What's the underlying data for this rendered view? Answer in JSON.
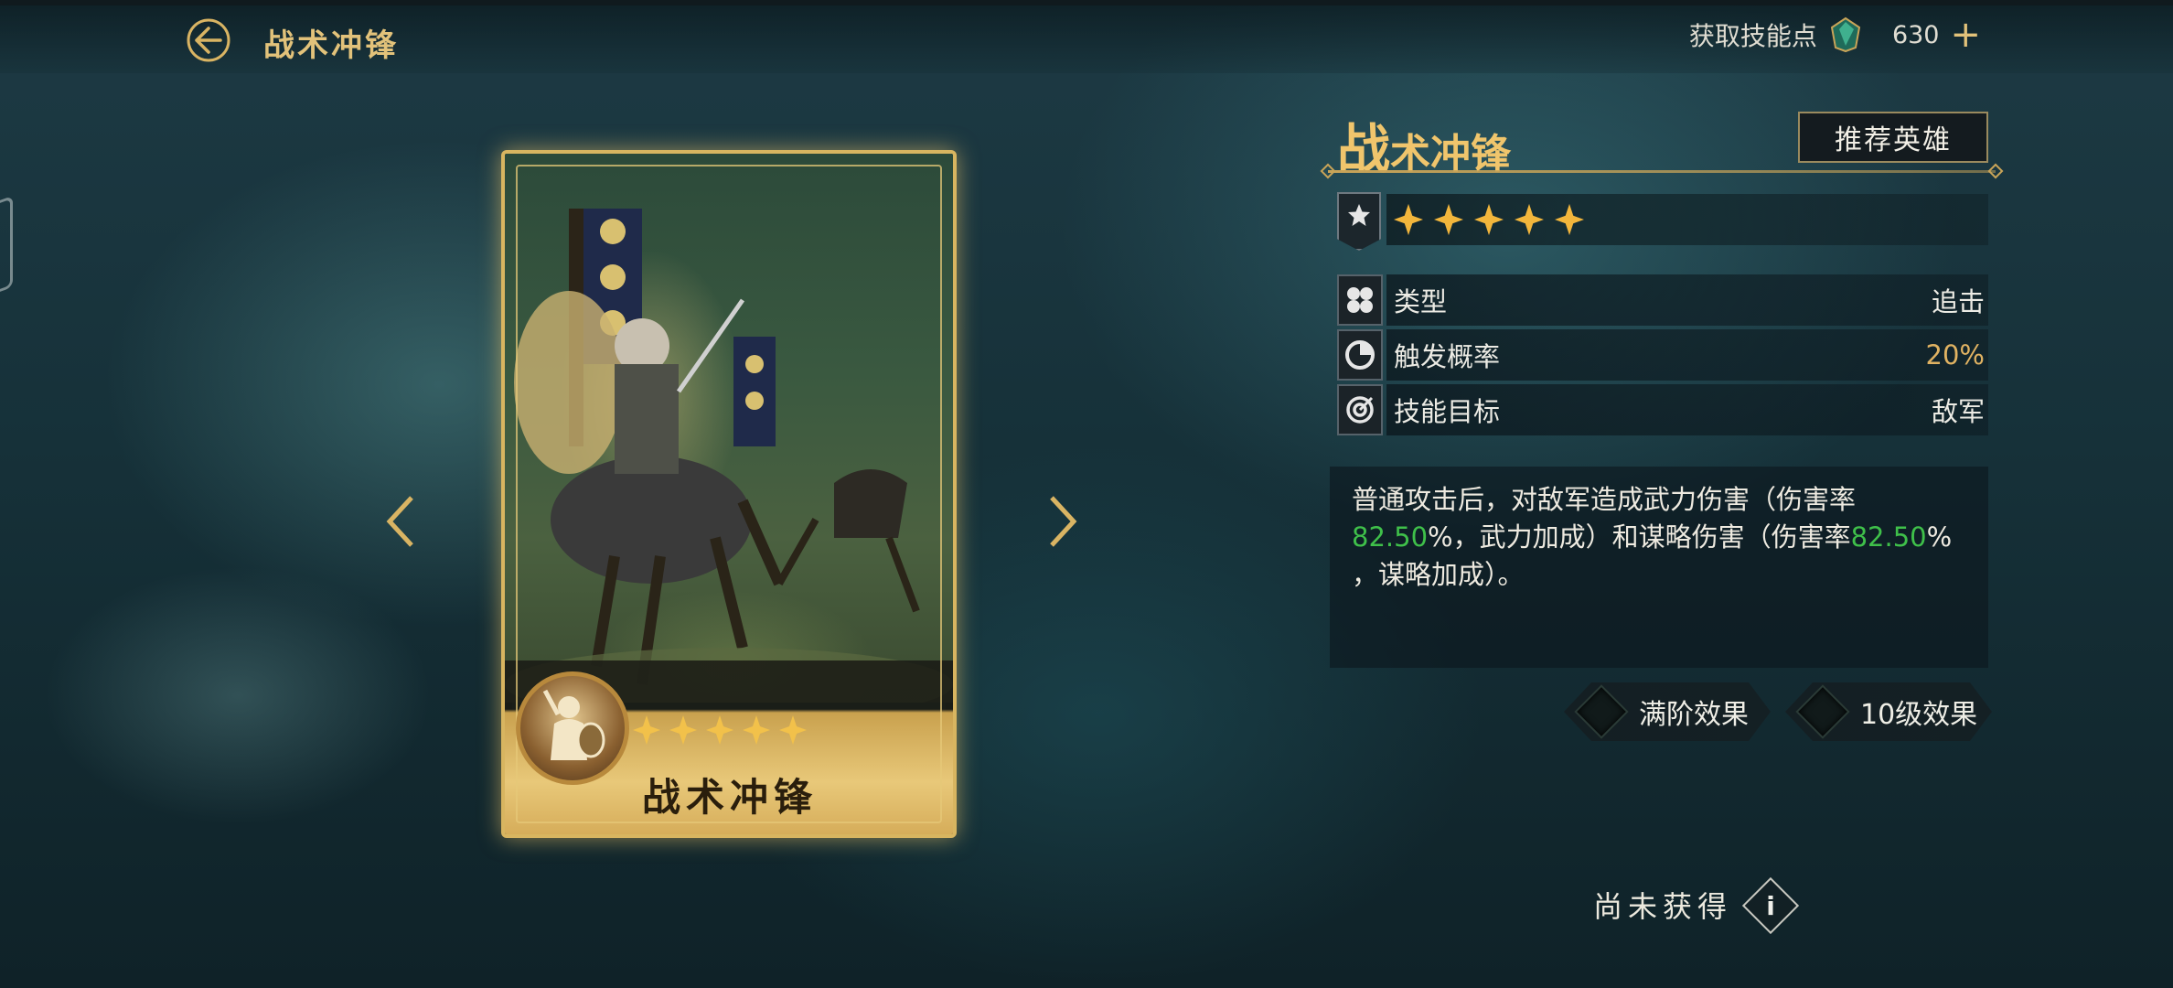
{
  "header": {
    "title": "战术冲锋",
    "skill_points_label": "获取技能点",
    "skill_points_value": "630",
    "add_label": "+"
  },
  "card": {
    "name": "战术冲锋",
    "stars": 5
  },
  "skill": {
    "title_first": "战",
    "title_rest": "术冲锋",
    "recommend_label": "推荐英雄",
    "stars": 5,
    "attributes": [
      {
        "label": "类型",
        "value": "追击",
        "icon": "clover-icon"
      },
      {
        "label": "触发概率",
        "value": "20%",
        "icon": "pie-chart-icon"
      },
      {
        "label": "技能目标",
        "value": "敌军",
        "icon": "target-icon"
      }
    ],
    "description": {
      "p1": "普通攻击后，对敌军造成武力伤害（伤害率",
      "v1": "82.50",
      "p2": "%，武力加成）和谋略伤害（伤害率",
      "v2": "82.50",
      "p3": "%",
      "p4": "，谋略加成）。"
    },
    "effect_buttons": [
      "满阶效果",
      "10级效果"
    ],
    "status": "尚未获得",
    "info_label": "i"
  },
  "colors": {
    "gold": "#e2c27a",
    "highlight_green": "#3fc04a",
    "value_gold": "#e0b262"
  }
}
